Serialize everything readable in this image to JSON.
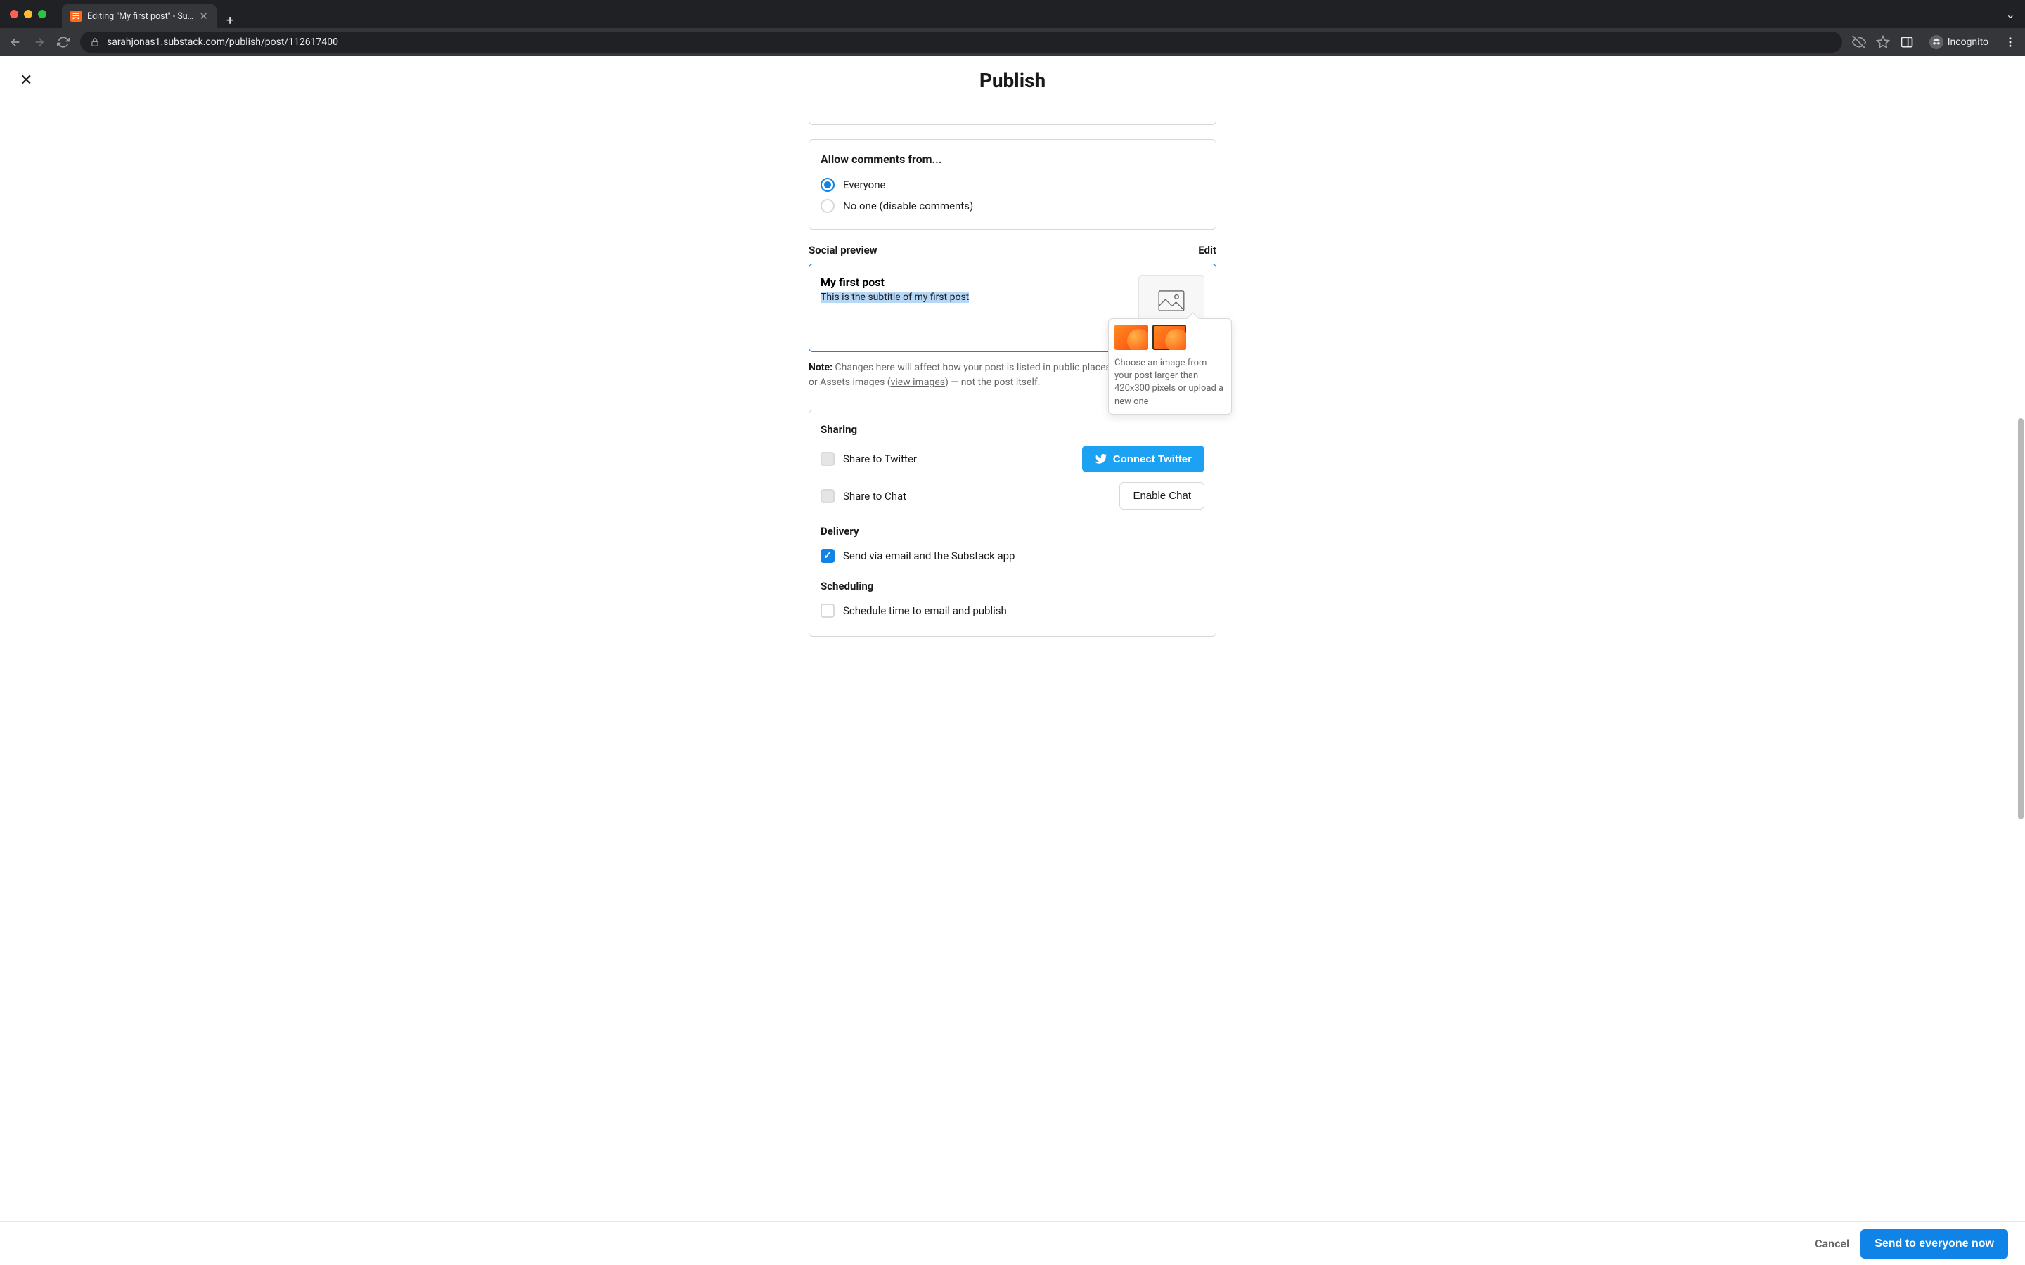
{
  "browser": {
    "tab_title": "Editing \"My first post\" - Subst…",
    "url": "sarahjonas1.substack.com/publish/post/112617400",
    "profile_label": "Incognito"
  },
  "header": {
    "title": "Publish"
  },
  "comments_section": {
    "heading": "Allow comments from...",
    "options": [
      {
        "label": "Everyone",
        "checked": true
      },
      {
        "label": "No one (disable comments)",
        "checked": false
      }
    ]
  },
  "social_preview": {
    "section_label": "Social preview",
    "edit_label": "Edit",
    "title": "My first post",
    "subtitle": "This is the subtitle of my first post"
  },
  "image_popover": {
    "helper_text": "Choose an image from your post larger than 420x300 pixels or upload a new one"
  },
  "note": {
    "label": "Note:",
    "text_before_link": " Changes here will affect how your post is listed in public places (e.g. Twitter, Substack or Assets images (",
    "link_text": "view images",
    "text_after_link": ") — not the post itself."
  },
  "sharing": {
    "heading": "Sharing",
    "share_twitter_label": "Share to Twitter",
    "connect_twitter_label": "Connect Twitter",
    "share_chat_label": "Share to Chat",
    "enable_chat_label": "Enable Chat"
  },
  "delivery": {
    "heading": "Delivery",
    "option_label": "Send via email and the Substack app",
    "checked": true
  },
  "scheduling": {
    "heading": "Scheduling",
    "option_label": "Schedule time to email and publish",
    "checked": false
  },
  "footer": {
    "cancel_label": "Cancel",
    "publish_label": "Send to everyone now"
  }
}
